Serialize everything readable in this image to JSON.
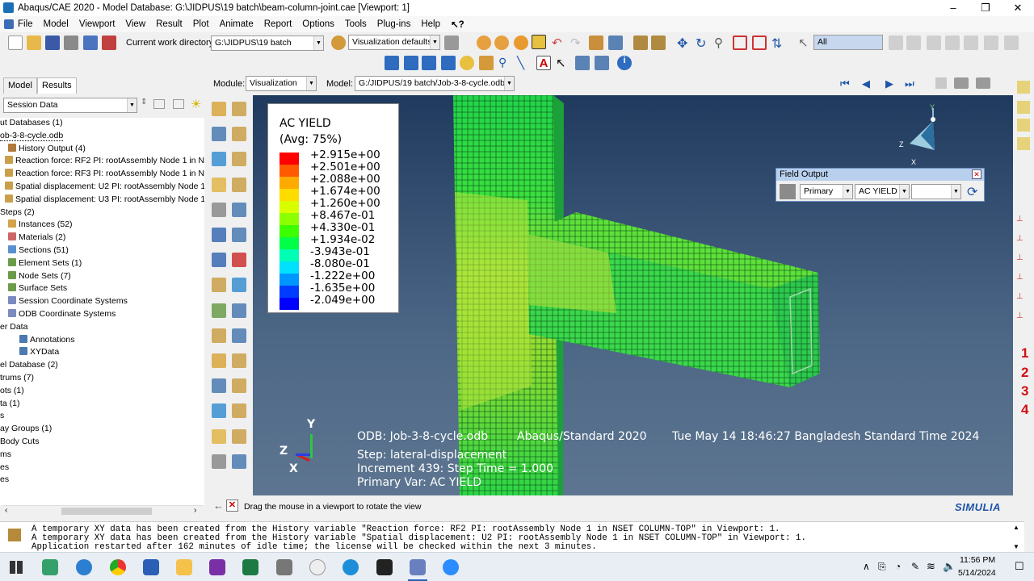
{
  "window": {
    "title": "Abaqus/CAE 2020 - Model Database: G:\\JIDPUS\\19 batch\\beam-column-joint.cae [Viewport: 1]"
  },
  "menu": [
    "File",
    "Model",
    "Viewport",
    "View",
    "Result",
    "Plot",
    "Animate",
    "Report",
    "Options",
    "Tools",
    "Plug-ins",
    "Help"
  ],
  "toolbar": {
    "cwd_label": "Current work directory:",
    "cwd_value": "G:\\JIDPUS\\19 batch",
    "vis_defaults": "Visualization defaults",
    "selection_filter": "All"
  },
  "context": {
    "module_label": "Module:",
    "module_value": "Visualization",
    "model_label": "Model:",
    "model_value": "G:/JIDPUS/19 batch/Job-3-8-cycle.odb"
  },
  "tabs": [
    "Model",
    "Results"
  ],
  "session_combo": "Session Data",
  "tree": [
    "ut Databases (1)",
    "ob-3-8-cycle.odb",
    "History Output (4)",
    "Reaction force: RF2 PI: rootAssembly Node 1 in NSET CO",
    "Reaction force: RF3 PI: rootAssembly Node 1 in NSET CO",
    "Spatial displacement: U2 PI: rootAssembly Node 1 in NS",
    "Spatial displacement: U3 PI: rootAssembly Node 1 in NS",
    "Steps (2)",
    "Instances (52)",
    "Materials (2)",
    "Sections (51)",
    "Element Sets (1)",
    "Node Sets (7)",
    "Surface Sets",
    "Session Coordinate Systems",
    "ODB Coordinate Systems",
    "er Data",
    "Annotations",
    "XYData",
    "el Database (2)",
    "trums (7)",
    "ots (1)",
    "ta (1)",
    "s",
    "ay Groups (1)",
    "Body Cuts",
    "ms",
    "es",
    "es"
  ],
  "legend": {
    "title1": "AC YIELD",
    "title2": "(Avg: 75%)",
    "values": [
      "+2.915e+00",
      "+2.501e+00",
      "+2.088e+00",
      "+1.674e+00",
      "+1.260e+00",
      "+8.467e-01",
      "+4.330e-01",
      "+1.934e-02",
      "-3.943e-01",
      "-8.080e-01",
      "-1.222e+00",
      "-1.635e+00",
      "-2.049e+00"
    ],
    "colors": [
      "#ff0000",
      "#ff5a00",
      "#ffaa00",
      "#ffdc00",
      "#d7ff00",
      "#8cff00",
      "#3cff00",
      "#00ff46",
      "#00ffb4",
      "#00e1ff",
      "#0096ff",
      "#003cff",
      "#0000ff"
    ]
  },
  "info": {
    "odb": "ODB: Job-3-8-cycle.odb",
    "solver": "Abaqus/Standard 2020",
    "date": "Tue May 14 18:46:27 Bangladesh Standard Time 2024",
    "step": "Step: lateral-displacement",
    "increment": "Increment     439: Step Time =     1.000",
    "primary": "Primary Var: AC YIELD"
  },
  "triad": {
    "y": "Y",
    "z": "Z",
    "x": "X"
  },
  "field_output": {
    "title": "Field Output",
    "primary": "Primary",
    "variable": "AC YIELD"
  },
  "prompt": "Drag the mouse in a viewport to rotate the view",
  "brand": "SIMULIA",
  "messages": [
    "A temporary XY data has been created from the History variable \"Reaction force: RF2 PI: rootAssembly Node 1 in NSET COLUMN-TOP\" in Viewport: 1.",
    "A temporary XY data has been created from the History variable \"Spatial displacement: U2 PI: rootAssembly Node 1 in NSET COLUMN-TOP\" in Viewport: 1.",
    "Application restarted after 162 minutes of idle time; the license will be checked within the next 3 minutes."
  ],
  "right_numbers": [
    "1",
    "2",
    "3",
    "4"
  ],
  "clock": {
    "time": "11:56 PM",
    "date": "5/14/2024"
  }
}
